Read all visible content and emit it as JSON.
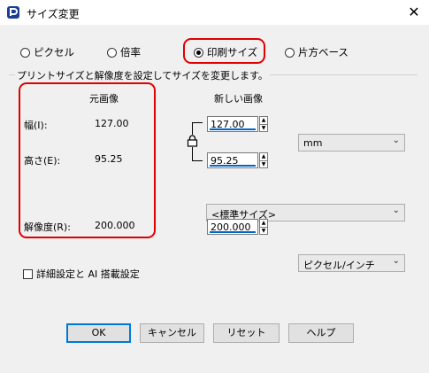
{
  "window": {
    "title": "サイズ変更",
    "close_glyph": "✕"
  },
  "mode": {
    "options": [
      {
        "label": "ピクセル",
        "selected": false
      },
      {
        "label": "倍率",
        "selected": false
      },
      {
        "label": "印刷サイズ",
        "selected": true
      },
      {
        "label": "片方ベース",
        "selected": false
      }
    ]
  },
  "group": {
    "label": "プリントサイズと解像度を設定してサイズを変更します。"
  },
  "original": {
    "header": "元画像",
    "width_label": "幅(I):",
    "width_value": "127.00",
    "height_label": "高さ(E):",
    "height_value": "95.25",
    "resolution_label": "解像度(R):",
    "resolution_value": "200.000"
  },
  "new": {
    "header": "新しい画像",
    "width_value": "127.00",
    "height_value": "95.25",
    "unit": "mm",
    "preset": "<標準サイズ>",
    "resolution_value": "200.000",
    "resolution_unit": "ピクセル/インチ"
  },
  "advanced": {
    "label": "詳細設定と AI 搭載設定",
    "checked": false
  },
  "buttons": {
    "ok": "OK",
    "cancel": "キャンセル",
    "reset": "リセット",
    "help": "ヘルプ"
  },
  "colors": {
    "highlight": "#e00000",
    "accent": "#0078d7"
  }
}
